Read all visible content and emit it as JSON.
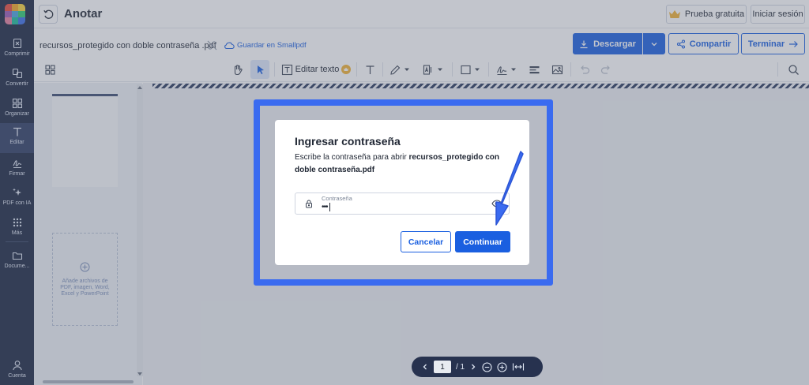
{
  "app": {
    "title": "Anotar"
  },
  "header": {
    "trial_label": "Prueba gratuita",
    "login_label": "Iniciar sesión"
  },
  "file": {
    "name": "recursos_protegido con doble contraseña .pdf",
    "save_label": "Guardar en Smallpdf"
  },
  "actions": {
    "download_label": "Descargar",
    "share_label": "Compartir",
    "finish_label": "Terminar"
  },
  "sidebar": {
    "items": [
      {
        "label": "Comprimir",
        "icon": "compress-icon"
      },
      {
        "label": "Convertir",
        "icon": "convert-icon"
      },
      {
        "label": "Organizar",
        "icon": "organize-icon"
      },
      {
        "label": "Editar",
        "icon": "edit-text-icon",
        "active": true
      },
      {
        "label": "Firmar",
        "icon": "sign-icon"
      },
      {
        "label": "PDF con IA",
        "icon": "sparkle-icon"
      },
      {
        "label": "Más",
        "icon": "grid-dots-icon"
      },
      {
        "label": "Docume...",
        "icon": "folder-icon"
      }
    ],
    "account_label": "Cuenta"
  },
  "toolbar": {
    "edit_text_label": "Editar texto"
  },
  "thumbnails": {
    "add_files_text": "Añade archivos de PDF, imagen, Word, Excel y PowerPoint"
  },
  "dialog": {
    "title": "Ingresar contraseña",
    "description_prefix": "Escribe la contraseña para abrir ",
    "description_file": "recursos_protegido con doble contraseña.pdf",
    "password_label": "Contraseña",
    "password_value": "•••",
    "cancel_label": "Cancelar",
    "continue_label": "Continuar"
  },
  "pager": {
    "current_page": "1",
    "total_label": "/ 1"
  },
  "colors": {
    "accent": "#1a5fe0",
    "sidebar_bg": "#1b2642",
    "highlight": "#3a6bf0",
    "pager_bg": "#27324f"
  }
}
